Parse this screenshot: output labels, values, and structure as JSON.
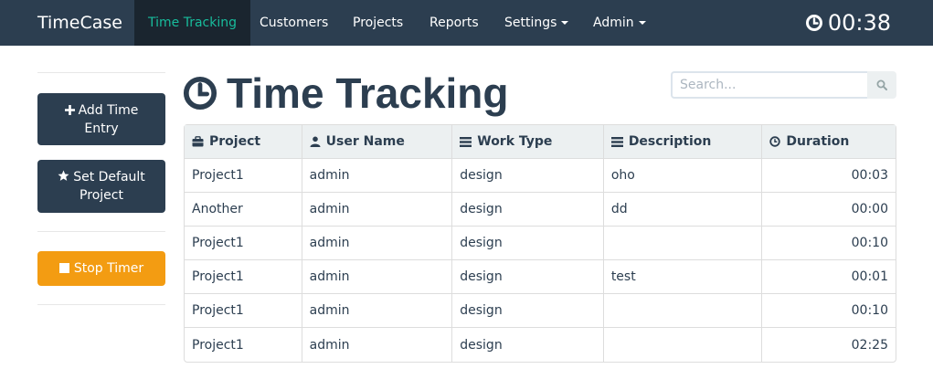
{
  "navbar": {
    "brand": "TimeCase",
    "items": [
      {
        "label": "Time Tracking",
        "active": true
      },
      {
        "label": "Customers"
      },
      {
        "label": "Projects"
      },
      {
        "label": "Reports"
      },
      {
        "label": "Settings",
        "dropdown": true
      },
      {
        "label": "Admin",
        "dropdown": true
      }
    ],
    "timer": "00:38"
  },
  "sidebar": {
    "add_time_entry": "Add Time Entry",
    "set_default_project": "Set Default Project",
    "stop_timer": "Stop Timer"
  },
  "page": {
    "title": "Time Tracking"
  },
  "search": {
    "placeholder": "Search..."
  },
  "table": {
    "headers": {
      "project": "Project",
      "user_name": "User Name",
      "work_type": "Work Type",
      "description": "Description",
      "duration": "Duration"
    },
    "rows": [
      {
        "project": "Project1",
        "user_name": "admin",
        "work_type": "design",
        "description": "oho",
        "duration": "00:03"
      },
      {
        "project": "Another",
        "user_name": "admin",
        "work_type": "design",
        "description": "dd",
        "duration": "00:00"
      },
      {
        "project": "Project1",
        "user_name": "admin",
        "work_type": "design",
        "description": "",
        "duration": "00:10"
      },
      {
        "project": "Project1",
        "user_name": "admin",
        "work_type": "design",
        "description": "test",
        "duration": "00:01"
      },
      {
        "project": "Project1",
        "user_name": "admin",
        "work_type": "design",
        "description": "",
        "duration": "00:10"
      },
      {
        "project": "Project1",
        "user_name": "admin",
        "work_type": "design",
        "description": "",
        "duration": "02:25"
      }
    ]
  },
  "colors": {
    "navbar_bg": "#2c3e50",
    "nav_active_text": "#18bc9c",
    "primary_button": "#2c3e50",
    "warning_button": "#f39c12",
    "table_header_bg": "#ecf0f1"
  },
  "icons": {
    "timer": "clock-icon",
    "add": "plus-icon",
    "default": "star-icon",
    "stop": "stop-icon",
    "title": "clock-icon",
    "search": "search-icon",
    "project": "briefcase-icon",
    "user": "user-icon",
    "work_type": "list-icon",
    "description": "list-icon",
    "duration": "clock-icon"
  }
}
